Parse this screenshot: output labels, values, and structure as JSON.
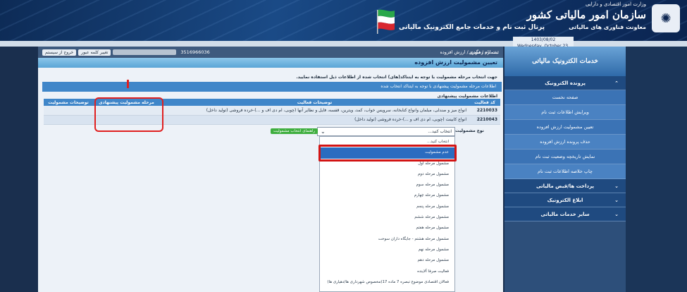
{
  "header": {
    "ministry": "وزارت امور اقتصادی و دارایی",
    "org_title": "سازمان امور مالیاتی کشور",
    "org_sub": "معاونت فناوری های مالیاتی",
    "portal_title": "پرتال ثبت نام و خدمات جامع الکترونیک مالیاتی",
    "date_fa": "1403/08/02",
    "date_en": "Wednesday, October 23, 2024"
  },
  "topbar": {
    "breadcrumb": "ثبت نام / مودی / ارزش افزوده",
    "tracking_label": "شماره رهگیری:",
    "tracking_number": "3516966036",
    "change_password": "تغییر کلمه عبور",
    "logout": "خروج از سیستم"
  },
  "main": {
    "page_title": "تعیین مشمولیت ارزش افزوده",
    "instruction": "جهت انتخاب مرحله مشمولیت با توجه به ایتناکد(های) انتخاب شده از اطلاعات ذیل استفاده نمایید.",
    "info_bar": "اطلاعات مرحله مشمولیت پیشنهادی با توجه به ایتناکد انتخاب شده",
    "suggested_label": "اطلاعات مشمولیت پیشنهادی",
    "columns": {
      "code": "کد فعالیت",
      "desc": "توضیحات فعالیت",
      "stage": "مرحله مشمولیت پیشنهادی",
      "notes": "توضیحات مشمولیت"
    },
    "rows": [
      {
        "code": "2210033",
        "desc": "انواع میز و صندلی، مبلمان وانواع کتابخانه، سرویس خواب، کمد، ویترین، قفسه، فایل و نظایر آنها (چوبی، ام دی اف و ...)-خرده فروشی (تولید داخل)",
        "stage": "",
        "notes": ""
      },
      {
        "code": "2210043",
        "desc": "انواع کابینت (چوبی، ام دی اف و ...)-خرده فروشی (تولید داخل)",
        "stage": "",
        "notes": ""
      }
    ],
    "type_label": "نوع مشمولیت",
    "select_value": "انتخاب کنید...",
    "guide_button": "راهنمای انتخاب مشمولیت",
    "dropdown_options": [
      "انتخاب کنید...",
      "عدم مشمولیت",
      "مشمول مرحله اول",
      "مشمول مرحله دوم",
      "مشمول مرحله سوم",
      "مشمول مرحله چهارم",
      "مشمول مرحله پنجم",
      "مشمول مرحله ششم",
      "مشمول مرحله هفتم",
      "مشمول مرحله هشتم - جایگاه داران سوخت",
      "مشمول مرحله نهم",
      "مشمول مرحله دهم",
      "فعالیت صرفا آلاینده",
      "فعالان اقتصادی موضوع تبصره 7 ماده 17(مخصوص شهرداری ها/دهیاری ها)"
    ],
    "selected_index": 1
  },
  "sidebar": {
    "header": "خدمات الکترونیک مالیاتی",
    "section1": "پرونده الکترونیک",
    "items": [
      "صفحه نخست",
      "ویرایش اطلاعات ثبت نام",
      "تعیین مشمولیت ارزش افزوده",
      "حذف پرونده ارزش افزوده",
      "نمایش تاریخچه وضعیت ثبت نام",
      "چاپ خلاصه اطلاعات ثبت نام"
    ],
    "sections": [
      "پرداخت ها/قبض مالیاتی",
      "ابلاغ الکترونیک",
      "سایر خدمات مالیاتی"
    ]
  }
}
